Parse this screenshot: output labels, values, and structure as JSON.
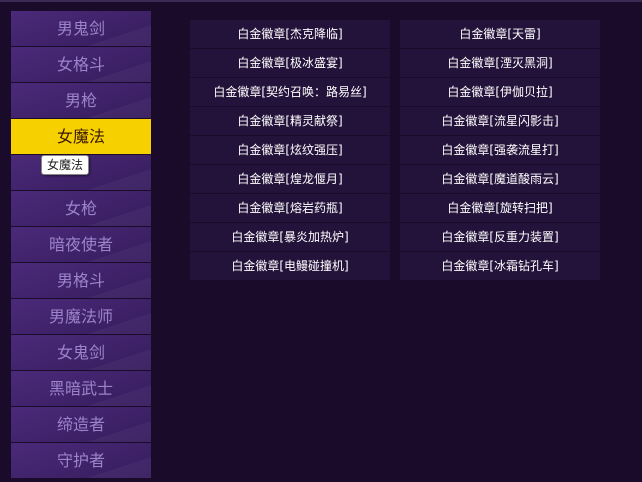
{
  "sidebar": {
    "items": [
      {
        "label": "男鬼剑",
        "active": false
      },
      {
        "label": "女格斗",
        "active": false
      },
      {
        "label": "男枪",
        "active": false
      },
      {
        "label": "女魔法",
        "active": true
      },
      {
        "label": "",
        "active": false
      },
      {
        "label": "女枪",
        "active": false
      },
      {
        "label": "暗夜使者",
        "active": false
      },
      {
        "label": "男格斗",
        "active": false
      },
      {
        "label": "男魔法师",
        "active": false
      },
      {
        "label": "女鬼剑",
        "active": false
      },
      {
        "label": "黑暗武士",
        "active": false
      },
      {
        "label": "缔造者",
        "active": false
      },
      {
        "label": "守护者",
        "active": false
      }
    ]
  },
  "tooltip": {
    "text": "女魔法"
  },
  "items": {
    "left": [
      "白金徽章[杰克降临]",
      "白金徽章[极冰盛宴]",
      "白金徽章[契约召唤：路易丝]",
      "白金徽章[精灵献祭]",
      "白金徽章[炫纹强压]",
      "白金徽章[煌龙偃月]",
      "白金徽章[熔岩药瓶]",
      "白金徽章[暴炎加热炉]",
      "白金徽章[电鳗碰撞机]"
    ],
    "right": [
      "白金徽章[天雷]",
      "白金徽章[湮灭黑洞]",
      "白金徽章[伊伽贝拉]",
      "白金徽章[流星闪影击]",
      "白金徽章[强袭流星打]",
      "白金徽章[魔道酸雨云]",
      "白金徽章[旋转扫把]",
      "白金徽章[反重力装置]",
      "白金徽章[冰霜钻孔车]"
    ]
  },
  "colors": {
    "background": "#1b0b2b",
    "sidebar_item": "#4a2a7a",
    "sidebar_active": "#f7d000",
    "sidebar_text": "#9b84c8",
    "cell_bg": "#23123a"
  }
}
